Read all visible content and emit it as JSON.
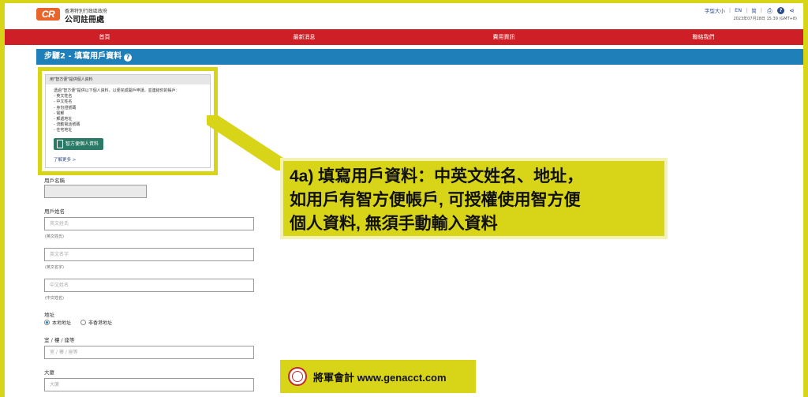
{
  "header": {
    "logo": "CR",
    "gov_line": "香港特別行政區政府",
    "registry_name": "公司註冊處",
    "font_size_label": "字型大小",
    "lang_en": "EN",
    "lang_sc": "简",
    "timestamp": "2023年07月28日 15:39 (GMT+8)"
  },
  "nav": {
    "items": [
      "首頁",
      "最新消息",
      "費用資訊",
      "聯絡我們"
    ]
  },
  "step": {
    "title": "步驟2 - 填寫用戶資料"
  },
  "iam_smart": {
    "heading": "用\"智方便\"提供個人資料",
    "intro": "透過\"智方便\"提供以下個人資料，以便完成開戶申請，並連結你的帳戶：",
    "fields": [
      "- 英文姓名",
      "- 中文姓名",
      "- 身份證號碼",
      "- 電郵",
      "- 郵遞地址",
      "- 流動電話號碼",
      "- 住宅地址"
    ],
    "button_label": "智方便個人資料",
    "learn_more": "了解更多 >"
  },
  "form": {
    "username_label": "用戶名稱",
    "username_value": "",
    "fullname_label": "用戶姓名",
    "en_surname_placeholder": "英文姓氏",
    "en_surname_hint": "(英文姓氏)",
    "en_given_placeholder": "英文名字",
    "en_given_hint": "(英文名字)",
    "zh_name_placeholder": "中文姓名",
    "zh_name_hint": "(中文姓名)",
    "address_label": "地址",
    "radio_local": "本地地址",
    "radio_overseas": "非香港地址",
    "room_label": "室 / 樓 / 座等",
    "room_placeholder": "室 / 樓 / 座等",
    "building_label": "大廈",
    "building_placeholder": "大廈"
  },
  "annotation": {
    "text": "4a) 填寫用戶資料：中英文姓名、地址，\n如用戶有智方便帳戶, 可授權使用智方便\n個人資料, 無須手動輸入資料"
  },
  "watermark": {
    "text": "將軍會計 www.genacct.com"
  },
  "colors": {
    "highlight": "#d8d418",
    "nav": "#cf1f26",
    "step_bar": "#1f7fb8",
    "iam_button": "#2b7a66"
  }
}
